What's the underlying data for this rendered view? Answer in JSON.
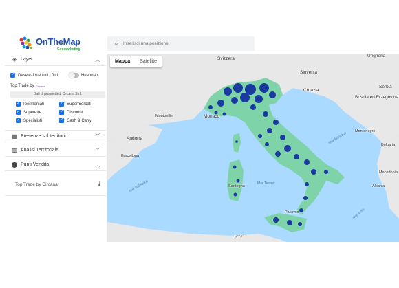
{
  "app": {
    "logo_text": "OnTheMap",
    "logo_subtitle": "Geomarketing"
  },
  "colors": {
    "accent": "#1a73e8",
    "brand_blue": "#1f4fa8",
    "brand_green": "#3fa44a",
    "store_points": "#1a3aa0",
    "land": "#e8e8e8",
    "italy_fill": "#7fd3a8",
    "sea": "#aadaff"
  },
  "sidebar": {
    "layer_section": {
      "icon": "layers-icon",
      "label": "Layer"
    },
    "deselect_label": "Deseleziona tutti i filtri",
    "heatmap_label": "Heatmap",
    "top_trade_label": "Top Trade by",
    "top_trade_badge": "Circana",
    "ownership_note": "Dati di proprietà di Circana S.r.l.",
    "filters": [
      {
        "label": "Ipermercati",
        "checked": true
      },
      {
        "label": "Supermercati",
        "checked": true
      },
      {
        "label": "Superette",
        "checked": true
      },
      {
        "label": "Discount",
        "checked": true
      },
      {
        "label": "Specialisti",
        "checked": true
      },
      {
        "label": "Cash & Carry",
        "checked": true
      }
    ],
    "presenze_label": "Presenze sul territorio",
    "analisi_label": "Analisi Territoriale",
    "punti_label": "Punti Vendita",
    "punti_item_label": "Top Trade by Circana"
  },
  "search": {
    "placeholder": "Inserisci una posizione"
  },
  "map": {
    "tabs": [
      "Mappa",
      "Satellite"
    ],
    "labels": {
      "svizzera": "Svizzera",
      "ungheria": "Ungheria",
      "slovenia": "Slovenia",
      "croazia": "Croazia",
      "bosnia": "Bosnia ed Erzegovina",
      "serbia": "Serbia",
      "monaco": "Monaco",
      "montpellier": "Montpellier",
      "andorra": "Andorra",
      "barcellona": "Barcellona",
      "montenegro": "Montenegro",
      "palermo": "Palermo",
      "mar_tirreno": "Mar Tirreno",
      "mar_adriatico": "Mar Adriatico",
      "mar_balearico": "Mar Balearico",
      "mar_ionio": "Mar Ionio",
      "bulgaria": "Bulgaria",
      "macedonia": "Macedonia",
      "albania": "Albania",
      "sardegna": "Sardegna",
      "tunisia": "تونس"
    }
  }
}
